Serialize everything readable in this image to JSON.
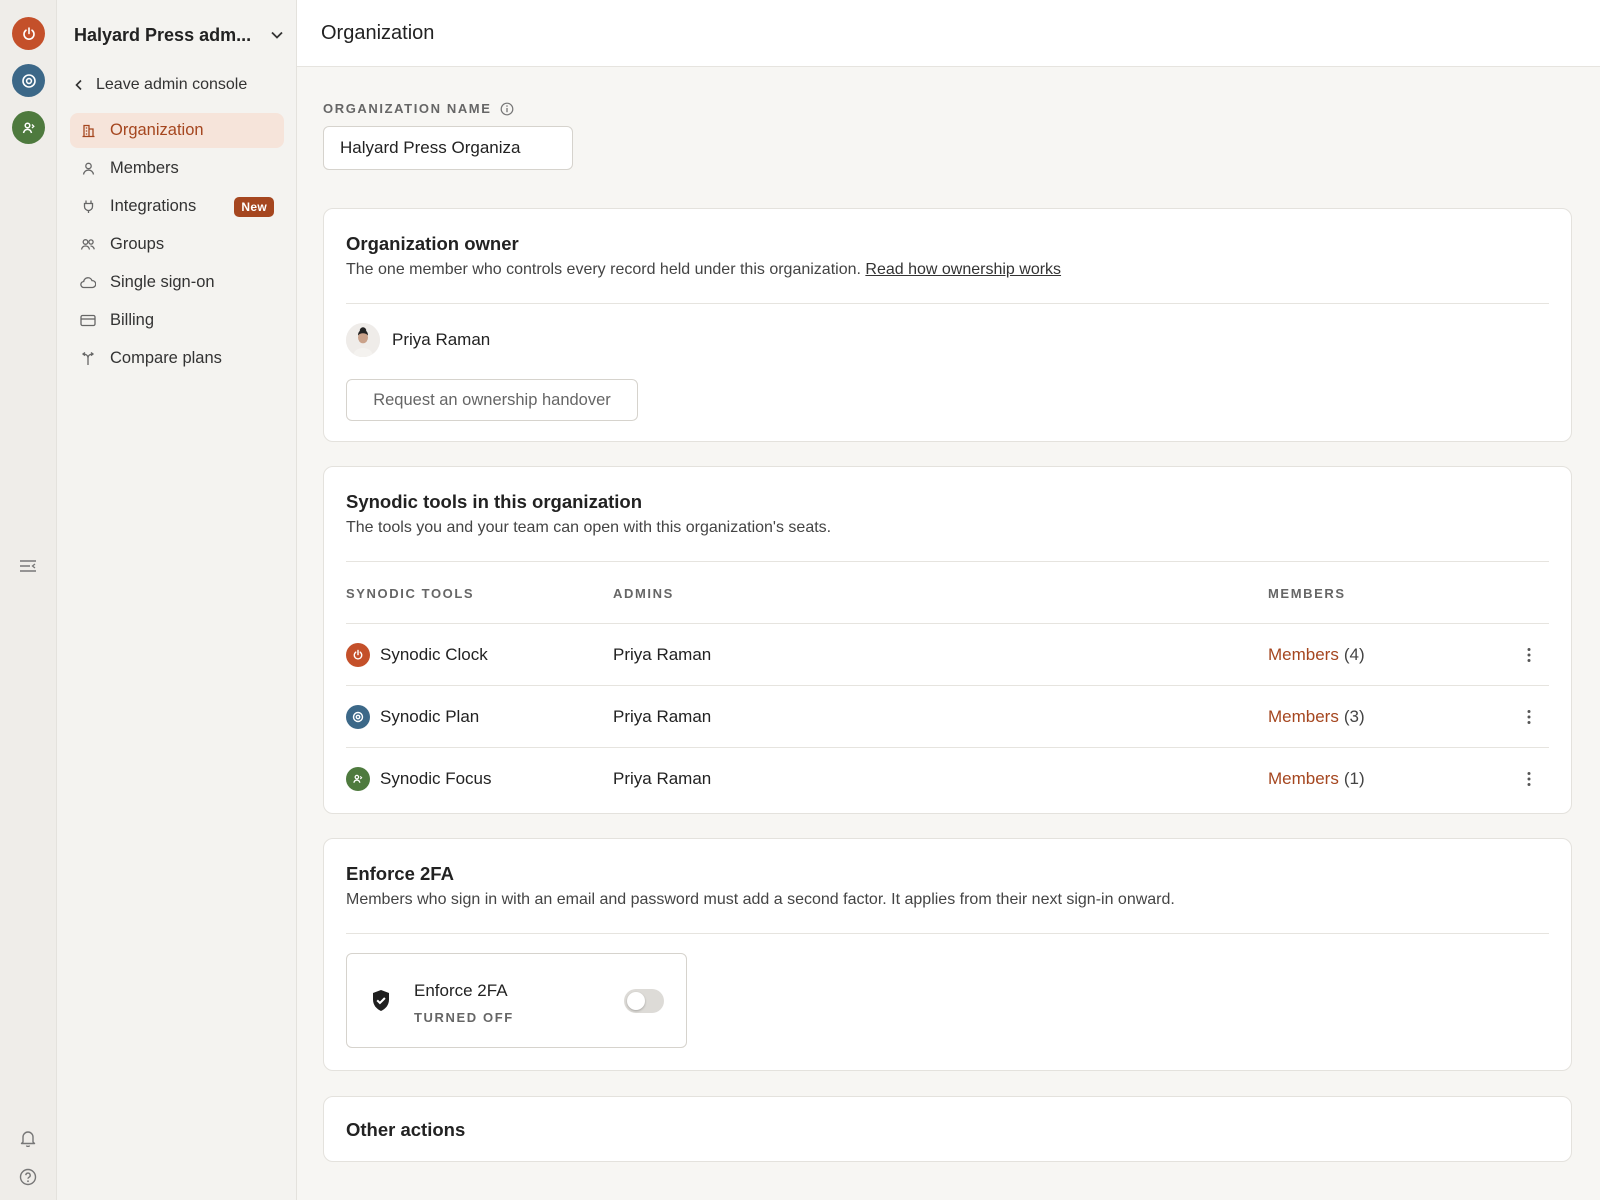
{
  "rail": {
    "apps": [
      {
        "icon": "power-icon",
        "color": "#c4502a"
      },
      {
        "icon": "target-icon",
        "color": "#3c6888"
      },
      {
        "icon": "person-icon",
        "color": "#4e7a3e"
      }
    ],
    "menu_icon": "collapse-menu-icon",
    "bell_icon": "bell-icon",
    "help_icon": "help-icon"
  },
  "sidebar": {
    "workspace_name": "Halyard Press adm...",
    "leave_label": "Leave admin console",
    "items": [
      {
        "label": "Organization",
        "icon": "building-icon",
        "active": true
      },
      {
        "label": "Members",
        "icon": "person-icon"
      },
      {
        "label": "Integrations",
        "icon": "plug-icon",
        "badge": "New"
      },
      {
        "label": "Groups",
        "icon": "group-icon"
      },
      {
        "label": "Single sign-on",
        "icon": "cloud-icon"
      },
      {
        "label": "Billing",
        "icon": "card-icon"
      },
      {
        "label": "Compare plans",
        "icon": "branch-icon"
      }
    ]
  },
  "header": {
    "title": "Organization"
  },
  "org_name": {
    "label": "ORGANIZATION NAME",
    "value": "Halyard Press Organiza"
  },
  "owner": {
    "title": "Organization owner",
    "desc": "The one member who controls every record held under this organization.",
    "link": "Read how ownership works",
    "name": "Priya Raman",
    "button": "Request an ownership handover"
  },
  "tools": {
    "title": "Synodic tools in this organization",
    "desc": "The tools you and your team can open with this organization's seats.",
    "headers": {
      "tool": "SYNODIC TOOLS",
      "admins": "ADMINS",
      "members": "MEMBERS"
    },
    "rows": [
      {
        "name": "Synodic Clock",
        "admin": "Priya Raman",
        "members_label": "Members",
        "count": "(4)",
        "color": "#c4502a",
        "icon": "power-icon"
      },
      {
        "name": "Synodic Plan",
        "admin": "Priya Raman",
        "members_label": "Members",
        "count": "(3)",
        "color": "#3c6888",
        "icon": "target-icon"
      },
      {
        "name": "Synodic Focus",
        "admin": "Priya Raman",
        "members_label": "Members",
        "count": "(1)",
        "color": "#4e7a3e",
        "icon": "person-icon"
      }
    ]
  },
  "twofa": {
    "title": "Enforce 2FA",
    "desc": "Members who sign in with an email and password must add a second factor. It applies from their next sign-in onward.",
    "toggle_title": "Enforce 2FA",
    "status": "TURNED OFF",
    "enabled": false
  },
  "other": {
    "title": "Other actions"
  }
}
